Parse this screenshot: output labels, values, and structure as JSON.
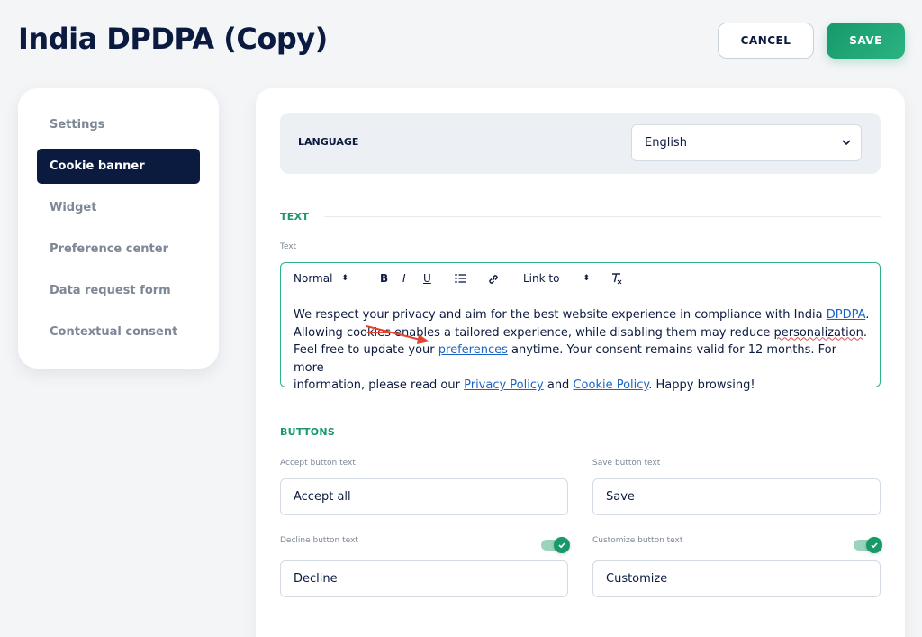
{
  "header": {
    "title": "India DPDPA (Copy)",
    "cancel_label": "CANCEL",
    "save_label": "SAVE"
  },
  "sidebar": {
    "items": [
      {
        "label": "Settings",
        "active": false
      },
      {
        "label": "Cookie banner",
        "active": true
      },
      {
        "label": "Widget",
        "active": false
      },
      {
        "label": "Preference center",
        "active": false
      },
      {
        "label": "Data request form",
        "active": false
      },
      {
        "label": "Contextual consent",
        "active": false
      }
    ]
  },
  "language": {
    "label": "LANGUAGE",
    "selected": "English"
  },
  "text_section": {
    "title": "TEXT",
    "field_label": "Text",
    "toolbar": {
      "header_select": "Normal",
      "bold": "B",
      "italic": "I",
      "underline": "U",
      "link_to_select": "Link to"
    },
    "content": {
      "p1": "We respect your privacy and aim for the best website experience in compliance with India ",
      "link_dpdpa": "DPDPA",
      "p2": ".",
      "p3a": "Allowing coo",
      "p3_strike": "kies",
      "p3b": " enables a tailored experience, while disabling them may reduce ",
      "p3_misspelled": "personalization",
      "p3c": ".",
      "p4a": "Feel free to update your ",
      "link_preferences": "preferences",
      "p4b": " anytime. Your consent remains valid for 12 months. For more",
      "p5a": "information, please read our ",
      "link_privacy": "Privacy Policy",
      "p5b": " and ",
      "link_cookie": "Cookie Policy",
      "p5c": ". Happy browsing!"
    }
  },
  "buttons_section": {
    "title": "BUTTONS",
    "accept": {
      "label": "Accept button text",
      "value": "Accept all"
    },
    "save": {
      "label": "Save button text",
      "value": "Save"
    },
    "decline": {
      "label": "Decline button text",
      "value": "Decline",
      "enabled": true
    },
    "customize": {
      "label": "Customize button text",
      "value": "Customize",
      "enabled": true
    }
  },
  "colors": {
    "brand_dark": "#0b1a3f",
    "accent_green": "#17996a",
    "link_blue": "#1b64c4",
    "annotation_red": "#e2442f"
  }
}
